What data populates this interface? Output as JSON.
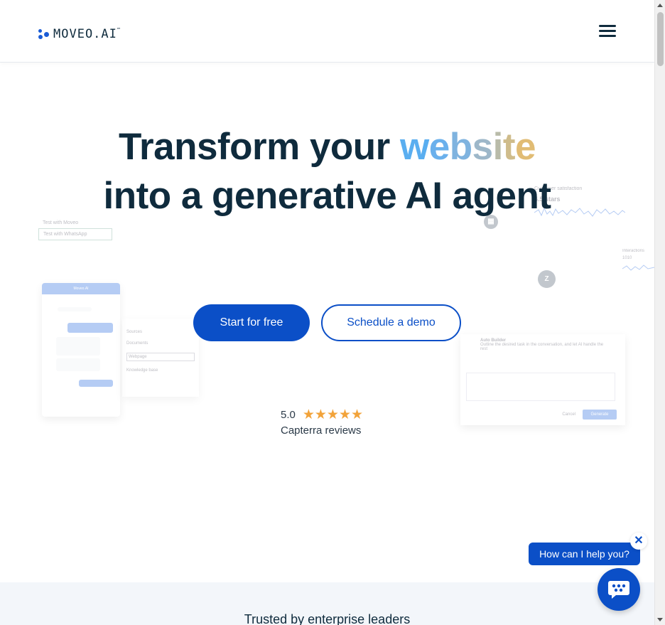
{
  "header": {
    "logo_text": "MOVEO.AI",
    "logo_trademark": "™",
    "menu_icon": "hamburger-menu-icon"
  },
  "hero": {
    "title_line1_prefix": "Transform your ",
    "title_highlight_letters": [
      "w",
      "e",
      "b",
      "s",
      "i",
      "t",
      "e"
    ],
    "title_line2": "into a generative AI agent",
    "primary_cta": "Start for free",
    "secondary_cta": "Schedule a demo",
    "rating_score": "5.0",
    "rating_stars": 5,
    "stars_glyphs": "★★★★★",
    "rating_source": "Capterra reviews"
  },
  "decor": {
    "test_moveo": "Test with Moveo",
    "test_whatsapp": "Test with WhatsApp",
    "chat_header": "Moveo.AI",
    "sources_title": "Sources",
    "source_documents": "Documents",
    "source_webpage": "Webpage",
    "source_knowledge": "Knowledge base",
    "builder_title": "Auto Builder",
    "builder_desc": "Outline the desired task in the conversation, and let AI handle the rest",
    "builder_cancel": "Cancel",
    "builder_generate": "Generate",
    "graph_label": "Customer satisfaction",
    "graph_value": "4.5 stars",
    "graph2_label": "Interactions",
    "graph2_value": "1010"
  },
  "band": {
    "title": "Trusted by enterprise leaders"
  },
  "chat_widget": {
    "tooltip": "How can I help you?",
    "close_glyph": "✕",
    "launcher_icon": "chat-bubble-icon"
  },
  "colors": {
    "brand_blue": "#0b4fc7",
    "heading": "#0f2b3d",
    "star": "#f2a33a",
    "gradient_start": "#5aaef0",
    "gradient_end": "#e1bc74"
  }
}
